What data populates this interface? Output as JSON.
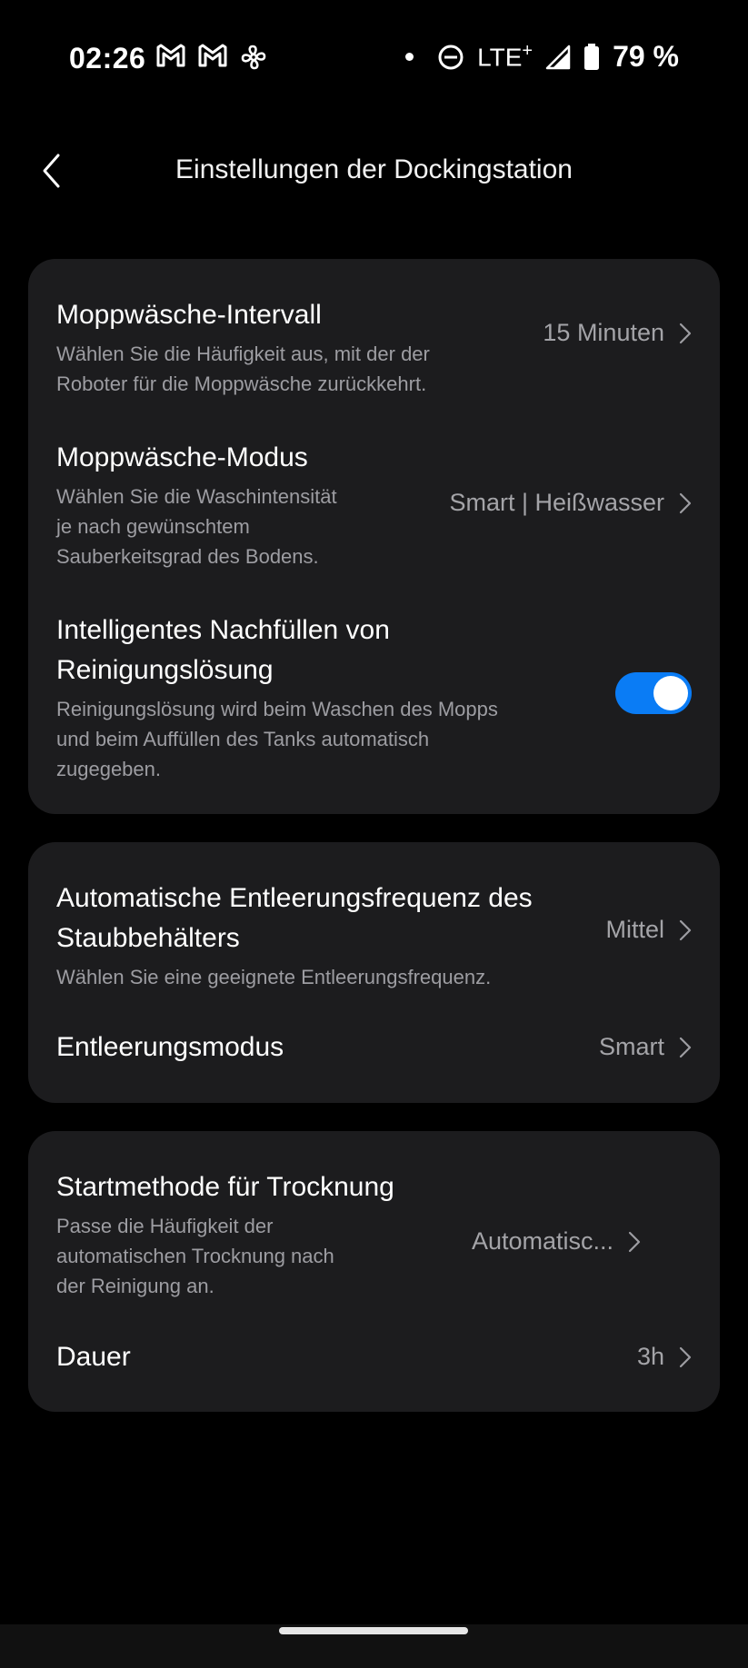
{
  "status_bar": {
    "time": "02:26",
    "notification_icons": [
      "gmail-icon",
      "gmail-icon",
      "fan-icon"
    ],
    "network": "LTE",
    "network_plus": "+",
    "battery": "79 %"
  },
  "header": {
    "title": "Einstellungen der Dockingstation"
  },
  "mop_card": {
    "interval": {
      "title": "Moppwäsche-Intervall",
      "desc_line1": "Wählen Sie die Häufigkeit aus, mit der der",
      "desc_line2": "Roboter für die Moppwäsche zurückkehrt.",
      "value": "15 Minuten"
    },
    "mode": {
      "title": "Moppwäsche-Modus",
      "desc_line1": "Wählen Sie die Waschintensität",
      "desc_line2": "je nach gewünschtem",
      "desc_line3": "Sauberkeitsgrad des Bodens.",
      "value": "Smart | Heißwasser"
    },
    "refill": {
      "title_line1": "Intelligentes Nachfüllen von",
      "title_line2": "Reinigungslösung",
      "desc_line1": "Reinigungslösung wird beim Waschen des Mopps",
      "desc_line2": "und beim Auffüllen des Tanks automatisch",
      "desc_line3": "zugegeben.",
      "enabled": true
    }
  },
  "empty_card": {
    "frequency": {
      "title_line1": "Automatische Entleerungsfrequenz des",
      "title_line2": "Staubbehälters",
      "desc": "Wählen Sie eine geeignete Entleerungsfrequenz.",
      "value": "Mittel"
    },
    "mode": {
      "title": "Entleerungsmodus",
      "value": "Smart"
    }
  },
  "dry_card": {
    "start": {
      "title": "Startmethode für Trocknung",
      "desc_line1": "Passe die Häufigkeit der",
      "desc_line2": "automatischen Trocknung nach",
      "desc_line3": "der Reinigung an.",
      "value": "Automatisc..."
    },
    "duration": {
      "title": "Dauer",
      "value": "3h"
    }
  },
  "colors": {
    "background": "#000000",
    "card": "#1c1c1e",
    "accent": "#0a7cf5",
    "secondary_text": "#9d9da2"
  }
}
